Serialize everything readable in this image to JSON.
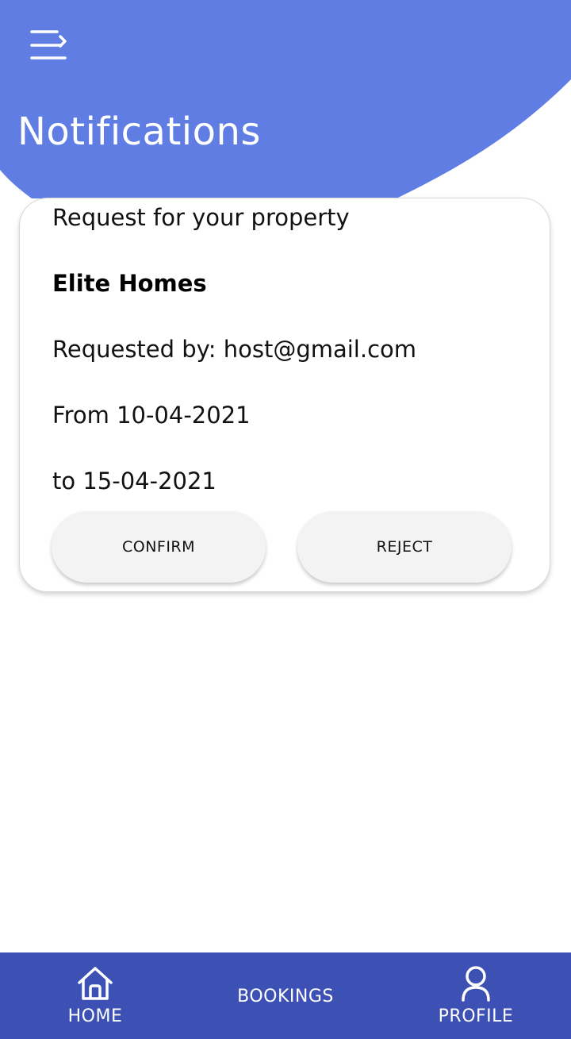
{
  "header": {
    "title": "Notifications",
    "menu_icon": "menu-arrow-icon",
    "accent_color": "#5f7de3"
  },
  "notification": {
    "heading": "Request for your property",
    "property_name": "Elite Homes",
    "requested_by": "Requested by: host@gmail.com",
    "from_date": "From 10-04-2021",
    "to_date": "to 15-04-2021",
    "confirm_label": "CONFIRM",
    "reject_label": "REJECT"
  },
  "bottom_nav": {
    "color": "#3d51b5",
    "items": [
      {
        "label": "HOME",
        "icon": "home-icon"
      },
      {
        "label": "BOOKINGS",
        "icon": ""
      },
      {
        "label": "PROFILE",
        "icon": "person-icon"
      }
    ]
  }
}
